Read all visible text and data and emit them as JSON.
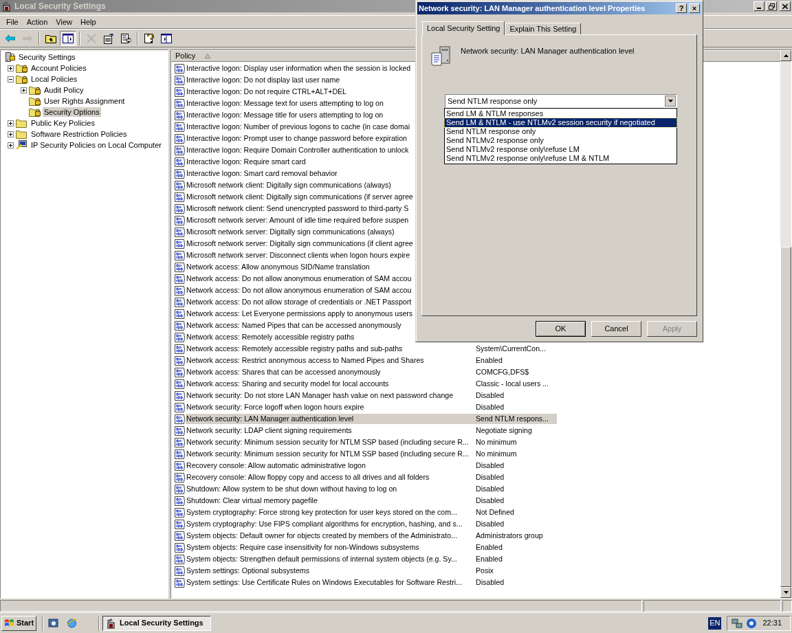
{
  "main_window": {
    "title": "Local Security Settings",
    "menu": [
      "File",
      "Action",
      "View",
      "Help"
    ],
    "toolbar": [
      {
        "kind": "back",
        "disabled": false,
        "pressed": false
      },
      {
        "kind": "forward",
        "disabled": true,
        "pressed": false
      },
      {
        "kind": "up",
        "disabled": false,
        "pressed": false
      },
      {
        "kind": "tree",
        "disabled": false,
        "pressed": true
      },
      {
        "kind": "delete",
        "disabled": true,
        "pressed": false
      },
      {
        "kind": "properties",
        "disabled": false,
        "pressed": false
      },
      {
        "kind": "export",
        "disabled": false,
        "pressed": false
      },
      {
        "kind": "help",
        "disabled": false,
        "pressed": false
      },
      {
        "kind": "pane",
        "disabled": false,
        "pressed": false
      }
    ],
    "tree": [
      {
        "label": "Security Settings",
        "kind": "root",
        "selected": false,
        "children": [
          {
            "label": "Account Policies",
            "kind": "lock-folder",
            "selected": false,
            "expanded": false
          },
          {
            "label": "Local Policies",
            "kind": "lock-folder",
            "selected": false,
            "expanded": true,
            "children": [
              {
                "label": "Audit Policy",
                "kind": "lock-folder",
                "selected": false,
                "expanded": false
              },
              {
                "label": "User Rights Assignment",
                "kind": "lock-folder",
                "selected": false
              },
              {
                "label": "Security Options",
                "kind": "lock-folder",
                "selected": true
              }
            ]
          },
          {
            "label": "Public Key Policies",
            "kind": "folder",
            "selected": false,
            "expanded": false
          },
          {
            "label": "Software Restriction Policies",
            "kind": "folder",
            "selected": false,
            "expanded": false
          },
          {
            "label": "IP Security Policies on Local Computer",
            "kind": "ip",
            "selected": false,
            "expanded": false
          }
        ]
      }
    ],
    "list": {
      "columns": [
        "Policy"
      ],
      "rows": [
        {
          "policy": "Interactive logon: Display user information when the session is locked",
          "selected": false
        },
        {
          "policy": "Interactive logon: Do not display last user name",
          "selected": false
        },
        {
          "policy": "Interactive logon: Do not require CTRL+ALT+DEL",
          "selected": false
        },
        {
          "policy": "Interactive logon: Message text for users attempting to log on",
          "selected": false
        },
        {
          "policy": "Interactive logon: Message title for users attempting to log on",
          "selected": false
        },
        {
          "policy": "Interactive logon: Number of previous logons to cache (in case domai",
          "selected": false
        },
        {
          "policy": "Interactive logon: Prompt user to change password before expiration",
          "selected": false
        },
        {
          "policy": "Interactive logon: Require Domain Controller authentication to unlock",
          "selected": false
        },
        {
          "policy": "Interactive logon: Require smart card",
          "selected": false
        },
        {
          "policy": "Interactive logon: Smart card removal behavior",
          "selected": false
        },
        {
          "policy": "Microsoft network client: Digitally sign communications (always)",
          "selected": false
        },
        {
          "policy": "Microsoft network client: Digitally sign communications (if server agree",
          "selected": false
        },
        {
          "policy": "Microsoft network client: Send unencrypted password to third-party S",
          "selected": false
        },
        {
          "policy": "Microsoft network server: Amount of idle time required before suspen",
          "selected": false
        },
        {
          "policy": "Microsoft network server: Digitally sign communications (always)",
          "selected": false
        },
        {
          "policy": "Microsoft network server: Digitally sign communications (if client agree",
          "selected": false
        },
        {
          "policy": "Microsoft network server: Disconnect clients when logon hours expire",
          "selected": false
        },
        {
          "policy": "Network access: Allow anonymous SID/Name translation",
          "selected": false
        },
        {
          "policy": "Network access: Do not allow anonymous enumeration of SAM accou",
          "selected": false
        },
        {
          "policy": "Network access: Do not allow anonymous enumeration of SAM accou",
          "selected": false
        },
        {
          "policy": "Network access: Do not allow storage of credentials or .NET Passport",
          "selected": false
        },
        {
          "policy": "Network access: Let Everyone permissions apply to anonymous users",
          "selected": false
        },
        {
          "policy": "Network access: Named Pipes that can be accessed anonymously",
          "selected": false
        },
        {
          "policy": "Network access: Remotely accessible registry paths",
          "selected": false
        },
        {
          "policy": "Network access: Remotely accessible registry paths and sub-paths",
          "setting": "System\\CurrentCon...",
          "selected": false
        },
        {
          "policy": "Network access: Restrict anonymous access to Named Pipes and Shares",
          "setting": "Enabled",
          "selected": false
        },
        {
          "policy": "Network access: Shares that can be accessed anonymously",
          "setting": "COMCFG,DFS$",
          "selected": false
        },
        {
          "policy": "Network access: Sharing and security model for local accounts",
          "setting": "Classic - local users ...",
          "selected": false
        },
        {
          "policy": "Network security: Do not store LAN Manager hash value on next password change",
          "setting": "Disabled",
          "selected": false
        },
        {
          "policy": "Network security: Force logoff when logon hours expire",
          "setting": "Disabled",
          "selected": false
        },
        {
          "policy": "Network security: LAN Manager authentication level",
          "setting": "Send NTLM respons...",
          "selected": true
        },
        {
          "policy": "Network security: LDAP client signing requirements",
          "setting": "Negotiate signing",
          "selected": false
        },
        {
          "policy": "Network security: Minimum session security for NTLM SSP based (including secure R...",
          "setting": "No minimum",
          "selected": false
        },
        {
          "policy": "Network security: Minimum session security for NTLM SSP based (including secure R...",
          "setting": "No minimum",
          "selected": false
        },
        {
          "policy": "Recovery console: Allow automatic administrative logon",
          "setting": "Disabled",
          "selected": false
        },
        {
          "policy": "Recovery console: Allow floppy copy and access to all drives and all folders",
          "setting": "Disabled",
          "selected": false
        },
        {
          "policy": "Shutdown: Allow system to be shut down without having to log on",
          "setting": "Disabled",
          "selected": false
        },
        {
          "policy": "Shutdown: Clear virtual memory pagefile",
          "setting": "Disabled",
          "selected": false
        },
        {
          "policy": "System cryptography: Force strong key protection for user keys stored on the com...",
          "setting": "Not Defined",
          "selected": false
        },
        {
          "policy": "System cryptography: Use FIPS compliant algorithms for encryption, hashing, and s...",
          "setting": "Disabled",
          "selected": false
        },
        {
          "policy": "System objects: Default owner for objects created by members of the Administrato...",
          "setting": "Administrators group",
          "selected": false
        },
        {
          "policy": "System objects: Require case insensitivity for non-Windows subsystems",
          "setting": "Enabled",
          "selected": false
        },
        {
          "policy": "System objects: Strengthen default permissions of internal system objects (e.g. Sy...",
          "setting": "Enabled",
          "selected": false
        },
        {
          "policy": "System settings: Optional subsystems",
          "setting": "Posix",
          "selected": false
        },
        {
          "policy": "System settings: Use Certificate Rules on Windows Executables for Software Restri...",
          "setting": "Disabled",
          "selected": false
        }
      ]
    }
  },
  "dialog": {
    "title": "Network security: LAN Manager authentication level Properties",
    "title_buttons": [
      "?",
      "×"
    ],
    "tabs": [
      {
        "label": "Local Security Setting",
        "selected": true
      },
      {
        "label": "Explain This Setting",
        "selected": false
      }
    ],
    "setting_name": "Network security: LAN Manager authentication level",
    "combo": {
      "value": "Send NTLM response only",
      "expanded": true
    },
    "options": [
      {
        "label": "Send LM & NTLM responses",
        "selected": false
      },
      {
        "label": "Send LM & NTLM - use NTLMv2 session security if negotiated",
        "selected": true
      },
      {
        "label": "Send NTLM response only",
        "selected": false
      },
      {
        "label": "Send NTLMv2 response only",
        "selected": false
      },
      {
        "label": "Send NTLMv2 response only\\refuse LM",
        "selected": false
      },
      {
        "label": "Send NTLMv2 response only\\refuse LM & NTLM",
        "selected": false
      }
    ],
    "buttons": [
      {
        "label": "OK",
        "disabled": false,
        "default": true
      },
      {
        "label": "Cancel",
        "disabled": false,
        "default": false
      },
      {
        "label": "Apply",
        "disabled": true,
        "default": false
      }
    ]
  },
  "taskbar": {
    "start": "Start",
    "tasks": [
      {
        "label": "Local Security Settings",
        "selected": true
      }
    ],
    "language": "EN",
    "clock": "22:31"
  }
}
